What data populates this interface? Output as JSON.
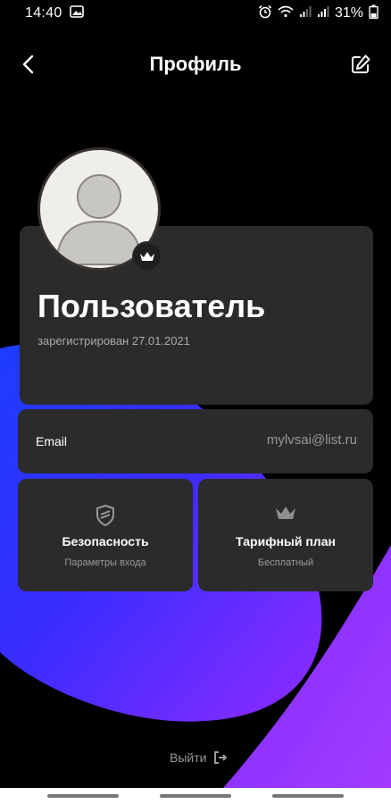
{
  "status_bar": {
    "time": "14:40",
    "battery": "31%"
  },
  "header": {
    "title": "Профиль",
    "back_icon": "chevron-left-icon",
    "edit_icon": "edit-icon"
  },
  "profile": {
    "name": "Пользователь",
    "registered": "зарегистрирован 27.01.2021",
    "badge_icon": "crown-icon"
  },
  "email": {
    "label": "Email",
    "value": "mylvsai@list.ru"
  },
  "tiles": [
    {
      "title": "Безопасность",
      "subtitle": "Параметры входа",
      "icon": "shield-icon"
    },
    {
      "title": "Тарифный план",
      "subtitle": "Бесплатный",
      "icon": "crown-icon"
    }
  ],
  "logout": {
    "label": "Выйти",
    "icon": "logout-icon"
  },
  "colors": {
    "background": "#000000",
    "card": "#2b2b2b",
    "accent_blue": "#1f44ff",
    "accent_purple": "#8a2bff"
  }
}
